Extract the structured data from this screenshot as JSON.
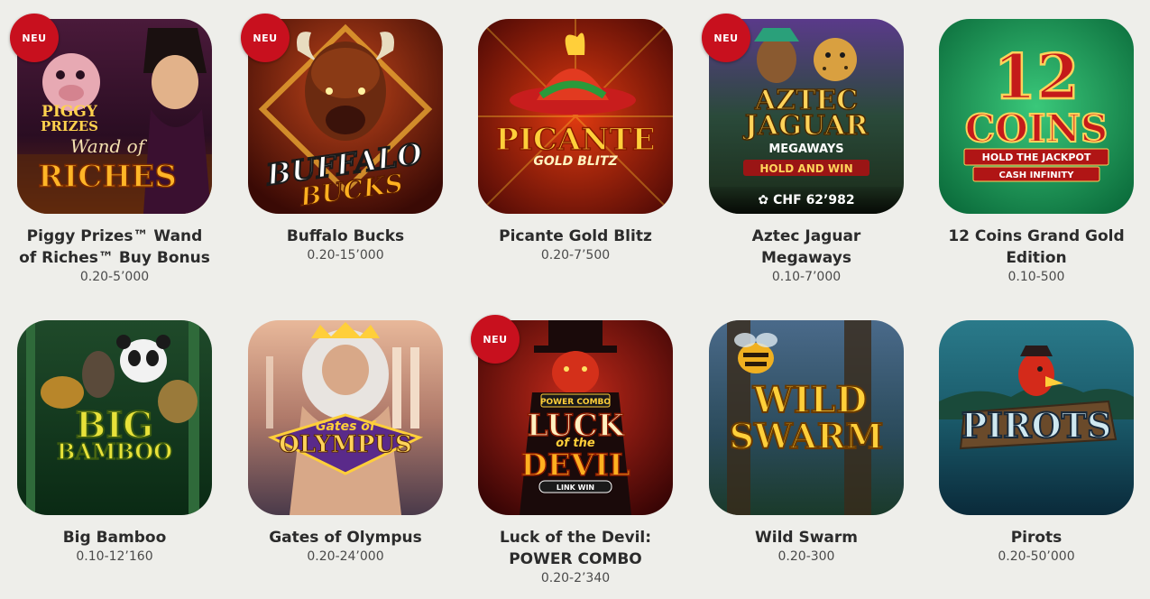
{
  "new_badge_label": "NEU",
  "games": [
    {
      "name": "Piggy Prizes™ Wand of Riches™ Buy Bonus",
      "range": "0.20-5’000",
      "is_new": true,
      "art": {
        "l1": "PIGGY",
        "l2": "PRIZES",
        "l3": "Wand of",
        "l4": "RICHES"
      }
    },
    {
      "name": "Buffalo Bucks",
      "range": "0.20-15’000",
      "is_new": true,
      "art": {
        "l1": "BUFFALO",
        "l2": "BUCKS"
      }
    },
    {
      "name": "Picante Gold Blitz",
      "range": "0.20-7’500",
      "is_new": false,
      "art": {
        "l1": "PICANTE",
        "l2": "GOLD BLITZ"
      }
    },
    {
      "name": "Aztec Jaguar Megaways",
      "range": "0.10-7’000",
      "is_new": true,
      "jackpot": "CHF 62’982",
      "art": {
        "l1": "AZTEC",
        "l2": "JAGUAR",
        "l3": "MEGAWAYS",
        "l4": "HOLD AND WIN"
      }
    },
    {
      "name": "12 Coins Grand Gold Edition",
      "range": "0.10-500",
      "is_new": false,
      "art": {
        "l1": "12",
        "l2": "COINS",
        "l3": "HOLD THE JACKPOT",
        "l4": "CASH INFINITY"
      }
    },
    {
      "name": "Big Bamboo",
      "range": "0.10-12’160",
      "is_new": false,
      "art": {
        "l1": "BIG",
        "l2": "BAMBOO"
      }
    },
    {
      "name": "Gates of Olympus",
      "range": "0.20-24’000",
      "is_new": false,
      "art": {
        "l1": "Gates of",
        "l2": "OLYMPUS"
      }
    },
    {
      "name": "Luck of the Devil: POWER COMBO",
      "range": "0.20-2’340",
      "is_new": true,
      "art": {
        "l1": "POWER COMBO",
        "l2": "LUCK",
        "l3": "of the",
        "l4": "DEVIL",
        "l5": "LINK WIN"
      }
    },
    {
      "name": "Wild Swarm",
      "range": "0.20-300",
      "is_new": false,
      "art": {
        "l1": "WILD",
        "l2": "SWARM"
      }
    },
    {
      "name": "Pirots",
      "range": "0.20-50’000",
      "is_new": false,
      "art": {
        "l1": "PIROTS"
      }
    }
  ]
}
